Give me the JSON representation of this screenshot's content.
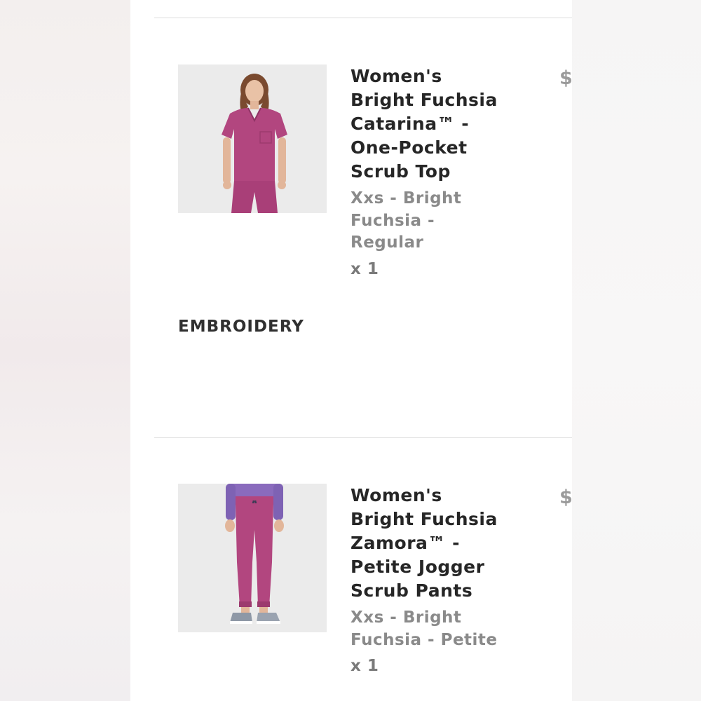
{
  "items": [
    {
      "title": "Women's Bright Fuchsia Catarina™ - One-Pocket Scrub Top",
      "variant": "Xxs - Bright Fuchsia - Regular",
      "quantity": "x 1",
      "price_visible": "$",
      "image_icon": "product-photo-scrub-top"
    },
    {
      "title": "Women's Bright Fuchsia Zamora™ - Petite Jogger Scrub Pants",
      "variant": "Xxs - Bright Fuchsia - Petite",
      "quantity": "x 1",
      "price_visible": "$",
      "image_icon": "product-photo-jogger-pants"
    }
  ],
  "embroidery": {
    "label": "EMBROIDERY"
  },
  "colors": {
    "fuchsia": "#b2467f",
    "title_text": "#262626",
    "variant_text": "#8a8a8a",
    "divider": "#dddddd"
  }
}
